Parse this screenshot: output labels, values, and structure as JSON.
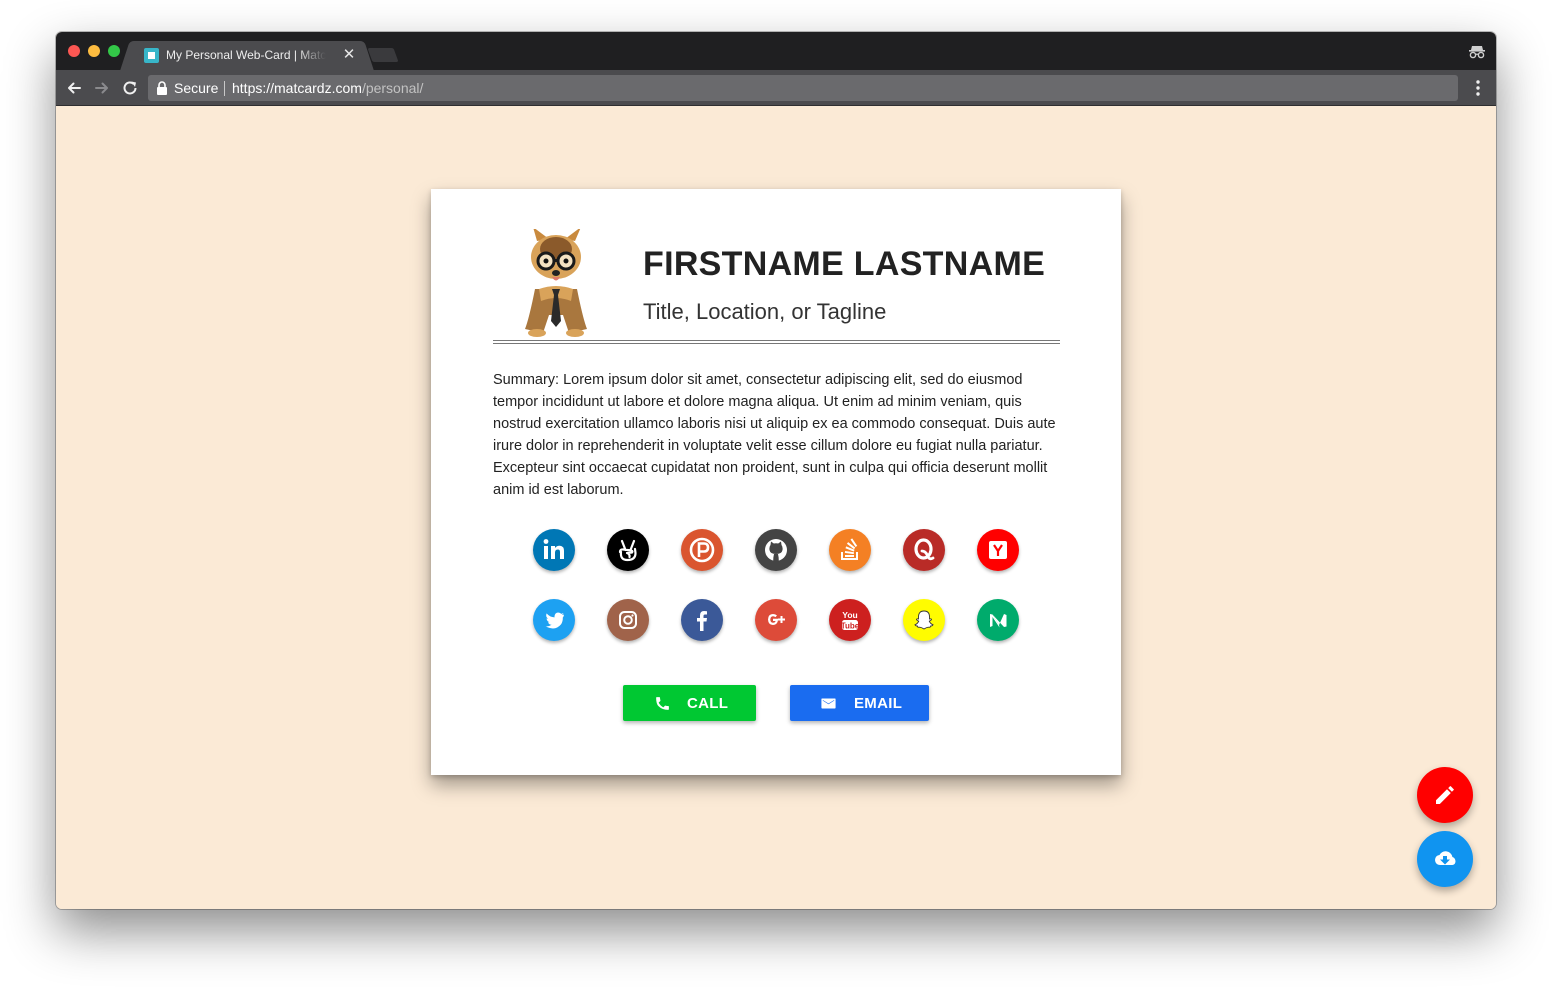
{
  "browser": {
    "tab_title": "My Personal Web-Card | Matcardz",
    "tab_close": "✕",
    "secure_label": "Secure",
    "url_host": "https://matcardz.com",
    "url_path": "/personal/"
  },
  "card": {
    "name": "FIRSTNAME LASTNAME",
    "tagline": "Title, Location, or Tagline",
    "summary": "Summary: Lorem ipsum dolor sit amet, consectetur adipiscing elit, sed do eiusmod tempor incididunt ut labore et dolore magna aliqua. Ut enim ad minim veniam, quis nostrud exercitation ullamco laboris nisi ut aliquip ex ea commodo consequat. Duis aute irure dolor in reprehenderit in voluptate velit esse cillum dolore eu fugiat nulla pariatur. Excepteur sint occaecat cupidatat non proident, sunt in culpa qui officia deserunt mollit anim id est laborum.",
    "social_row1": [
      {
        "icon": "linkedin-icon",
        "color": "#0077b5"
      },
      {
        "icon": "angellist-icon",
        "color": "#000000"
      },
      {
        "icon": "producthunt-icon",
        "color": "#da552f"
      },
      {
        "icon": "github-icon",
        "color": "#444444"
      },
      {
        "icon": "stackoverflow-icon",
        "color": "#f48024"
      },
      {
        "icon": "quora-icon",
        "color": "#b92b27"
      },
      {
        "icon": "hackernews-icon",
        "color": "#ff0000"
      }
    ],
    "social_row2": [
      {
        "icon": "twitter-icon",
        "color": "#1da1f2"
      },
      {
        "icon": "instagram-icon",
        "color": "#a0634a"
      },
      {
        "icon": "facebook-icon",
        "color": "#3b5998"
      },
      {
        "icon": "googleplus-icon",
        "color": "#dd4b39"
      },
      {
        "icon": "youtube-icon",
        "color": "#cd201f"
      },
      {
        "icon": "snapchat-icon",
        "color": "#fffc00"
      },
      {
        "icon": "medium-icon",
        "color": "#00ab6c"
      }
    ],
    "call_label": "CALL",
    "email_label": "EMAIL"
  },
  "colors": {
    "page_background": "#fbead6",
    "call_button": "#00c832",
    "email_button": "#1a6cf0",
    "edit_fab": "#ff0000",
    "download_fab": "#1094f0"
  }
}
